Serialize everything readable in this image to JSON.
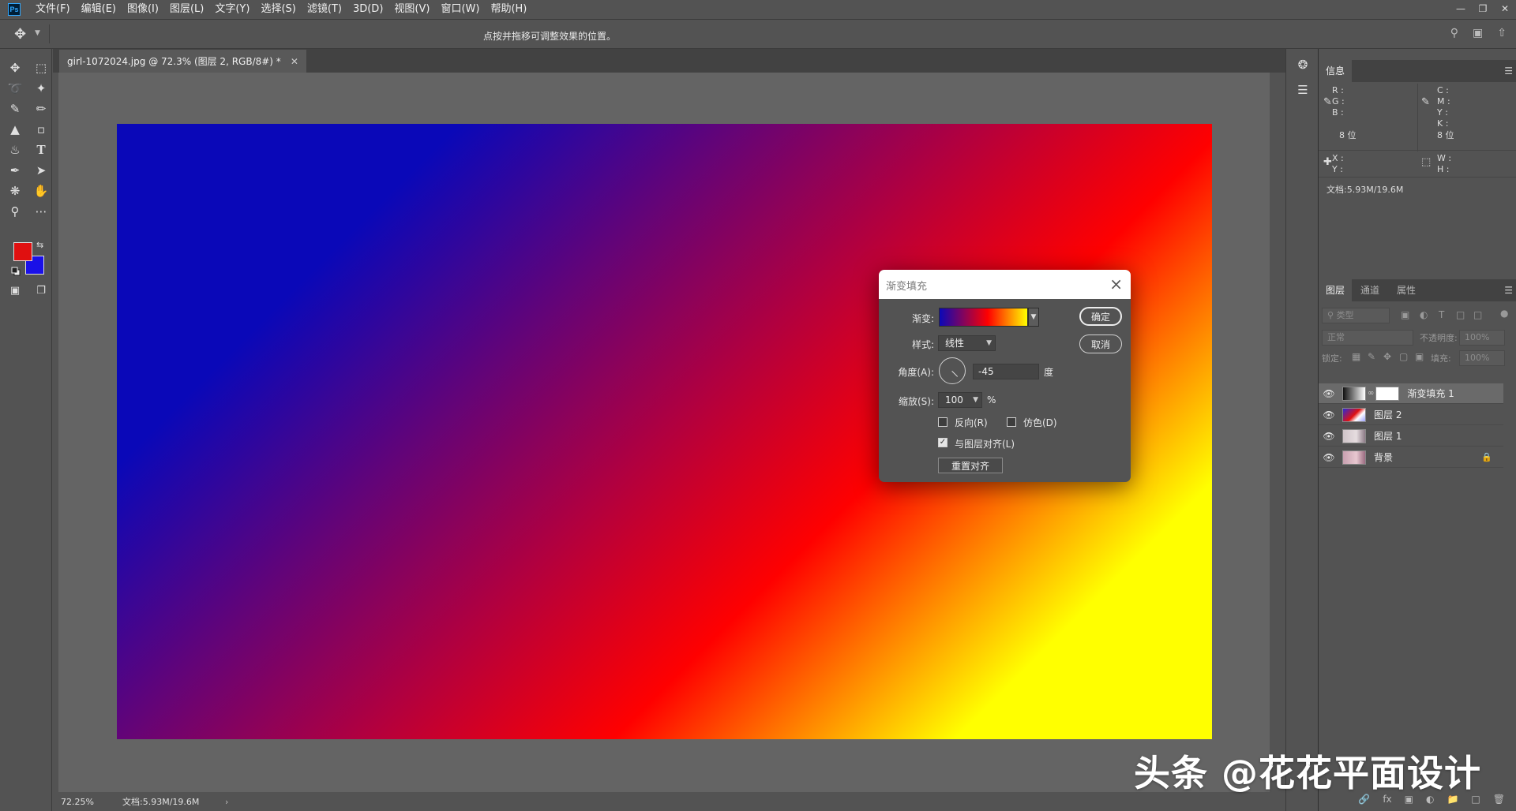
{
  "app": {
    "logo": "Ps"
  },
  "menu": [
    "文件(F)",
    "编辑(E)",
    "图像(I)",
    "图层(L)",
    "文字(Y)",
    "选择(S)",
    "滤镜(T)",
    "3D(D)",
    "视图(V)",
    "窗口(W)",
    "帮助(H)"
  ],
  "options_bar": {
    "hint": "点按并拖移可调整效果的位置。"
  },
  "document": {
    "tab_title": "girl-1072024.jpg @ 72.3% (图层 2, RGB/8#) *",
    "zoom": "72.25%",
    "doc_size": "文档:5.93M/19.6M"
  },
  "colors": {
    "foreground": "#e01010",
    "background": "#1a10e8",
    "gradient_stops": [
      "#0a08b8",
      "#b00040",
      "#ff0000",
      "#ffff00"
    ]
  },
  "info_panel": {
    "tab": "信息",
    "rgb_labels": [
      "R :",
      "G :",
      "B :"
    ],
    "cmyk_labels": [
      "C :",
      "M :",
      "Y :",
      "K :"
    ],
    "bits_left": "8 位",
    "bits_right": "8 位",
    "xy_labels": [
      "X :",
      "Y :"
    ],
    "wh_labels": [
      "W :",
      "H :"
    ],
    "doc_size": "文档:5.93M/19.6M"
  },
  "layers_panel": {
    "tabs": [
      "图层",
      "通道",
      "属性"
    ],
    "filter_placeholder": "类型",
    "blend_mode": "正常",
    "opacity_label": "不透明度:",
    "opacity_value": "100%",
    "lock_label": "锁定:",
    "fill_label": "填充:",
    "fill_value": "100%",
    "layers": [
      {
        "name": "渐变填充 1",
        "selected": true,
        "locked": false
      },
      {
        "name": "图层 2",
        "selected": false,
        "locked": false
      },
      {
        "name": "图层 1",
        "selected": false,
        "locked": false
      },
      {
        "name": "背景",
        "selected": false,
        "locked": true
      }
    ]
  },
  "gradient_dialog": {
    "title": "渐变填充",
    "gradient_label": "渐变:",
    "style_label": "样式:",
    "style_value": "线性",
    "angle_label": "角度(A):",
    "angle_value": "-45",
    "angle_unit": "度",
    "scale_label": "缩放(S):",
    "scale_value": "100",
    "scale_unit": "%",
    "reverse_label": "反向(R)",
    "reverse_checked": false,
    "dither_label": "仿色(D)",
    "dither_checked": false,
    "align_label": "与图层对齐(L)",
    "align_checked": true,
    "reset_align_label": "重置对齐",
    "ok_label": "确定",
    "cancel_label": "取消"
  },
  "watermark": "头条 @花花平面设计"
}
